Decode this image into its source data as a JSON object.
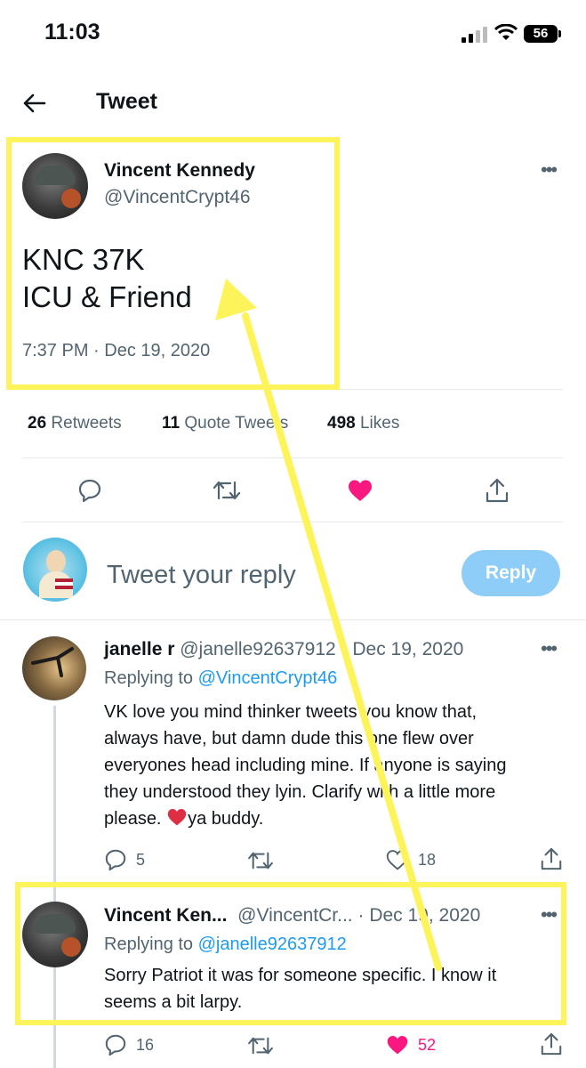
{
  "status_bar": {
    "time": "11:03",
    "battery": "56"
  },
  "header": {
    "title": "Tweet"
  },
  "main_tweet": {
    "name": "Vincent Kennedy",
    "handle": "@VincentCrypt46",
    "text_line1": "KNC 37K",
    "text_line2": "ICU & Friend",
    "timestamp": "7:37 PM · Dec 19, 2020"
  },
  "stats": {
    "retweets_count": "26",
    "retweets_label": "Retweets",
    "quotes_count": "11",
    "quotes_label": "Quote Tweets",
    "likes_count": "498",
    "likes_label": "Likes"
  },
  "composer": {
    "placeholder": "Tweet your reply",
    "button": "Reply"
  },
  "replies": [
    {
      "name": "janelle r",
      "handle": "@janelle92637912",
      "date": "· Dec 19, 2020",
      "replying_prefix": "Replying to ",
      "replying_to": "@VincentCrypt46",
      "text_lines": [
        "VK love you mind thinker tweets you know that,",
        "always have, but damn dude this one flew over",
        "everyones head including mine. If anyone is saying",
        "they understood they lyin.  Clarify with a little more",
        "please.",
        "ya buddy."
      ],
      "replies": "5",
      "likes": "18"
    },
    {
      "name": "Vincent Ken...",
      "handle": "@VincentCr...",
      "date": "· Dec 19, 2020",
      "replying_prefix": "Replying to ",
      "replying_to": "@janelle92637912",
      "text_lines": [
        "Sorry Patriot it was for someone specific. I know it",
        "seems a bit larpy."
      ],
      "replies": "16",
      "likes": "52"
    }
  ],
  "colors": {
    "highlight": "#fdf35a",
    "like": "#f91880",
    "link": "#1d9bf0",
    "reply_button": "#8ecdf7"
  }
}
